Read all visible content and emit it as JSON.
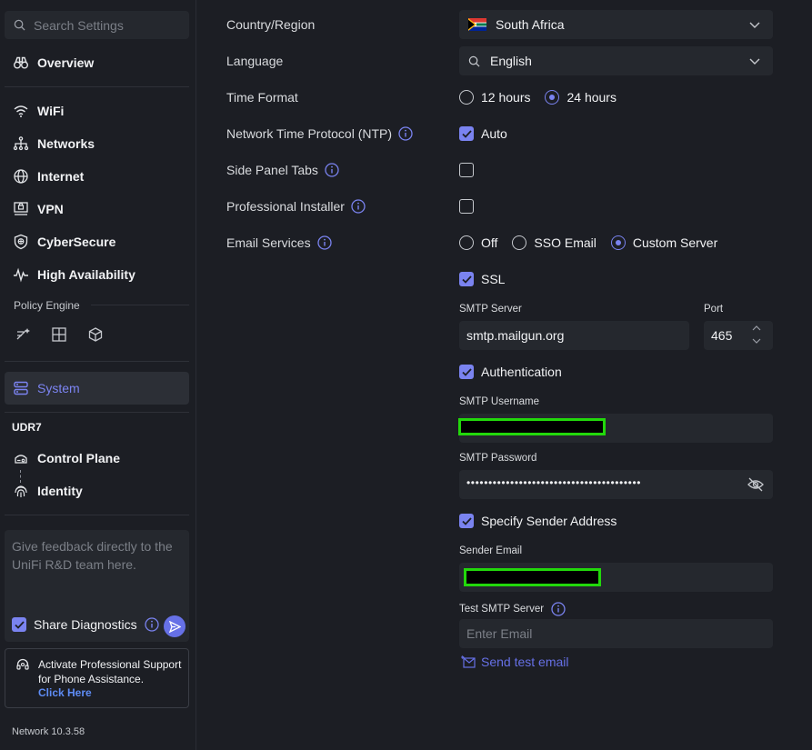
{
  "sidebar": {
    "search_placeholder": "Search Settings",
    "items": [
      {
        "label": "Overview",
        "icon": "binoculars-icon"
      },
      {
        "label": "WiFi",
        "icon": "wifi-icon"
      },
      {
        "label": "Networks",
        "icon": "network-tree-icon"
      },
      {
        "label": "Internet",
        "icon": "globe-icon"
      },
      {
        "label": "VPN",
        "icon": "vpn-icon"
      },
      {
        "label": "CyberSecure",
        "icon": "shield-icon"
      },
      {
        "label": "High Availability",
        "icon": "pulse-icon"
      }
    ],
    "policy_engine_label": "Policy Engine",
    "policy_icons": [
      "wand-icon",
      "grid-icon",
      "cube-icon"
    ],
    "system_label": "System",
    "device_label": "UDR7",
    "device_items": [
      {
        "label": "Control Plane",
        "icon": "router-icon"
      },
      {
        "label": "Identity",
        "icon": "fingerprint-icon"
      }
    ],
    "feedback_placeholder": "Give feedback directly to the UniFi R&D team here.",
    "share_diagnostics_label": "Share Diagnostics",
    "share_diagnostics_checked": true,
    "support_text": "Activate Professional Support for Phone Assistance.",
    "support_link": "Click Here",
    "version": "Network 10.3.58"
  },
  "settings": {
    "country_label": "Country/Region",
    "country_value": "South Africa",
    "language_label": "Language",
    "language_value": "English",
    "time_format_label": "Time Format",
    "time_format_options": [
      "12 hours",
      "24 hours"
    ],
    "time_format_selected": "24 hours",
    "ntp_label": "Network Time Protocol (NTP)",
    "ntp_value_label": "Auto",
    "side_panel_label": "Side Panel Tabs",
    "pro_installer_label": "Professional Installer",
    "email_services_label": "Email Services",
    "email_options": [
      "Off",
      "SSO Email",
      "Custom Server"
    ],
    "email_selected": "Custom Server",
    "ssl_label": "SSL",
    "smtp_server_label": "SMTP Server",
    "smtp_server_value": "smtp.mailgun.org",
    "port_label": "Port",
    "port_value": "465",
    "auth_label": "Authentication",
    "smtp_username_label": "SMTP Username",
    "smtp_password_label": "SMTP Password",
    "password_mask": "••••••••••••••••••••••••••••••••••••••••",
    "sender_label": "Specify Sender Address",
    "sender_email_label": "Sender Email",
    "test_smtp_label": "Test SMTP Server",
    "test_email_placeholder": "Enter Email",
    "send_test_label": "Send test email"
  },
  "colors": {
    "accent": "#7a83f0",
    "link": "#5e8cf5",
    "redaction_border": "#22d80b",
    "background": "#1c1e24",
    "field": "#25282e"
  }
}
